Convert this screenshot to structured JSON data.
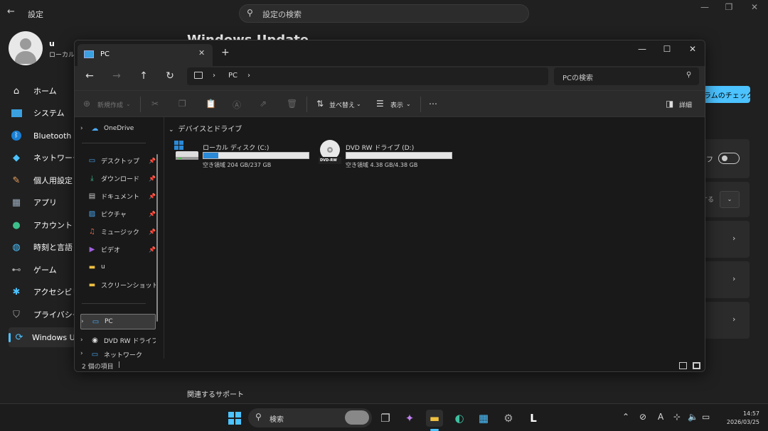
{
  "settings": {
    "title": "設定",
    "search_placeholder": "設定の検索",
    "heading_partial": "Windows Update",
    "user": {
      "name": "u",
      "account_type": "ローカル ア"
    },
    "nav": [
      {
        "label": "ホーム",
        "icon": "home-icon"
      },
      {
        "label": "システム",
        "icon": "monitor-icon"
      },
      {
        "label": "Bluetooth と",
        "icon": "bluetooth-icon"
      },
      {
        "label": "ネットワークと",
        "icon": "wifi-icon"
      },
      {
        "label": "個人用設定",
        "icon": "brush-icon"
      },
      {
        "label": "アプリ",
        "icon": "apps-icon"
      },
      {
        "label": "アカウント",
        "icon": "person-icon"
      },
      {
        "label": "時刻と言語",
        "icon": "globe-clock-icon"
      },
      {
        "label": "ゲーム",
        "icon": "gamepad-icon"
      },
      {
        "label": "アクセシビリティ",
        "icon": "accessibility-icon"
      },
      {
        "label": "プライバシーと",
        "icon": "shield-icon"
      },
      {
        "label": "Windows U",
        "icon": "update-icon"
      }
    ],
    "check_button": "ラムのチェック",
    "toggle_label": "フ",
    "dropdown_label": "する",
    "related_support": "関連するサポート"
  },
  "explorer": {
    "tab_title": "PC",
    "address": {
      "root": "PC"
    },
    "search_placeholder": "PCの検索",
    "toolbar": {
      "new": "新規作成",
      "sort": "並べ替え",
      "view": "表示",
      "more": "…",
      "details": "詳細"
    },
    "sidebar": [
      {
        "label": "OneDrive",
        "icon": "cloud-icon",
        "pinned": false,
        "chevron": true
      },
      {
        "label": "デスクトップ",
        "icon": "desktop-icon",
        "pinned": true
      },
      {
        "label": "ダウンロード",
        "icon": "download-icon",
        "pinned": true
      },
      {
        "label": "ドキュメント",
        "icon": "document-icon",
        "pinned": true
      },
      {
        "label": "ピクチャ",
        "icon": "picture-icon",
        "pinned": true
      },
      {
        "label": "ミュージック",
        "icon": "music-icon",
        "pinned": true
      },
      {
        "label": "ビデオ",
        "icon": "video-icon",
        "pinned": true
      },
      {
        "label": "u",
        "icon": "folder-icon",
        "pinned": false
      },
      {
        "label": "スクリーンショット",
        "icon": "folder-icon",
        "pinned": false
      },
      {
        "label": "PC",
        "icon": "pc-icon",
        "chevron": true
      },
      {
        "label": "DVD RW ドライブ",
        "icon": "dvd-icon",
        "chevron": true
      },
      {
        "label": "ネットワーク",
        "icon": "network-icon",
        "chevron": true
      }
    ],
    "group_title": "デバイスとドライブ",
    "drives": [
      {
        "name": "ローカル ディスク (C:)",
        "free": "空き領域 204 GB/237 GB",
        "used_fraction": 0.14,
        "icon": "hdd-icon"
      },
      {
        "name": "DVD RW ドライブ (D:)",
        "free": "空き領域 4.38 GB/4.38 GB",
        "used_fraction": 0.0,
        "icon": "dvd-disc-icon",
        "badge": "DVD-RW"
      }
    ],
    "status": "2 個の項目"
  },
  "taskbar": {
    "search_placeholder": "検索",
    "clock_time": "14:57",
    "clock_date": "2026/03/25",
    "ime": "A"
  }
}
